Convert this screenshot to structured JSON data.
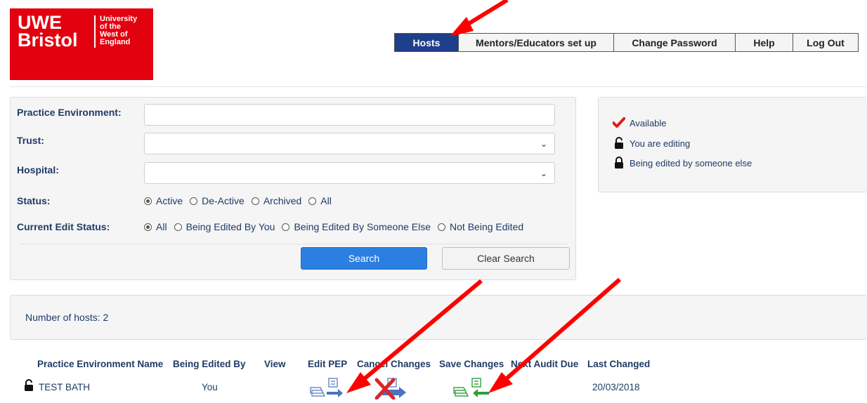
{
  "logo": {
    "line1": "UWE",
    "line2": "Bristol",
    "sub1": "University",
    "sub2": "of the",
    "sub3": "West of",
    "sub4": "England"
  },
  "nav": {
    "tabs": [
      {
        "label": "Hosts",
        "active": true
      },
      {
        "label": "Mentors/Educators set up",
        "active": false
      },
      {
        "label": "Change Password",
        "active": false
      },
      {
        "label": "Help",
        "active": false
      },
      {
        "label": "Log Out",
        "active": false
      }
    ]
  },
  "search": {
    "practice_env_label": "Practice Environment:",
    "practice_env_value": "",
    "trust_label": "Trust:",
    "trust_value": "",
    "hospital_label": "Hospital:",
    "hospital_value": "",
    "status_label": "Status:",
    "status_options": [
      "Active",
      "De-Active",
      "Archived",
      "All"
    ],
    "status_selected": "Active",
    "edit_status_label": "Current Edit Status:",
    "edit_status_options": [
      "All",
      "Being Edited By You",
      "Being Edited By Someone Else",
      "Not Being Edited"
    ],
    "edit_status_selected": "All",
    "search_button": "Search",
    "clear_button": "Clear Search"
  },
  "legend": {
    "items": [
      {
        "icon": "checkmark-icon",
        "label": "Available"
      },
      {
        "icon": "unlocked-icon",
        "label": "You are editing"
      },
      {
        "icon": "locked-icon",
        "label": "Being edited by someone else"
      }
    ]
  },
  "results": {
    "count_text": "Number of hosts: 2",
    "columns": [
      "Practice Environment Name",
      "Being Edited By",
      "View",
      "Edit PEP",
      "Cancel Changes",
      "Save Changes",
      "Next Audit Due",
      "Last Changed"
    ],
    "rows": [
      {
        "lock_icon": "unlocked-icon",
        "name": "TEST BATH",
        "edited_by": "You",
        "next_audit_due": "",
        "last_changed": "20/03/2018"
      }
    ]
  },
  "colors": {
    "brand_red": "#e3000f",
    "nav_active": "#1e3f8a",
    "search_button": "#2b7fe0",
    "label_text": "#1f3b66",
    "annotation_arrow": "#ff0000"
  }
}
